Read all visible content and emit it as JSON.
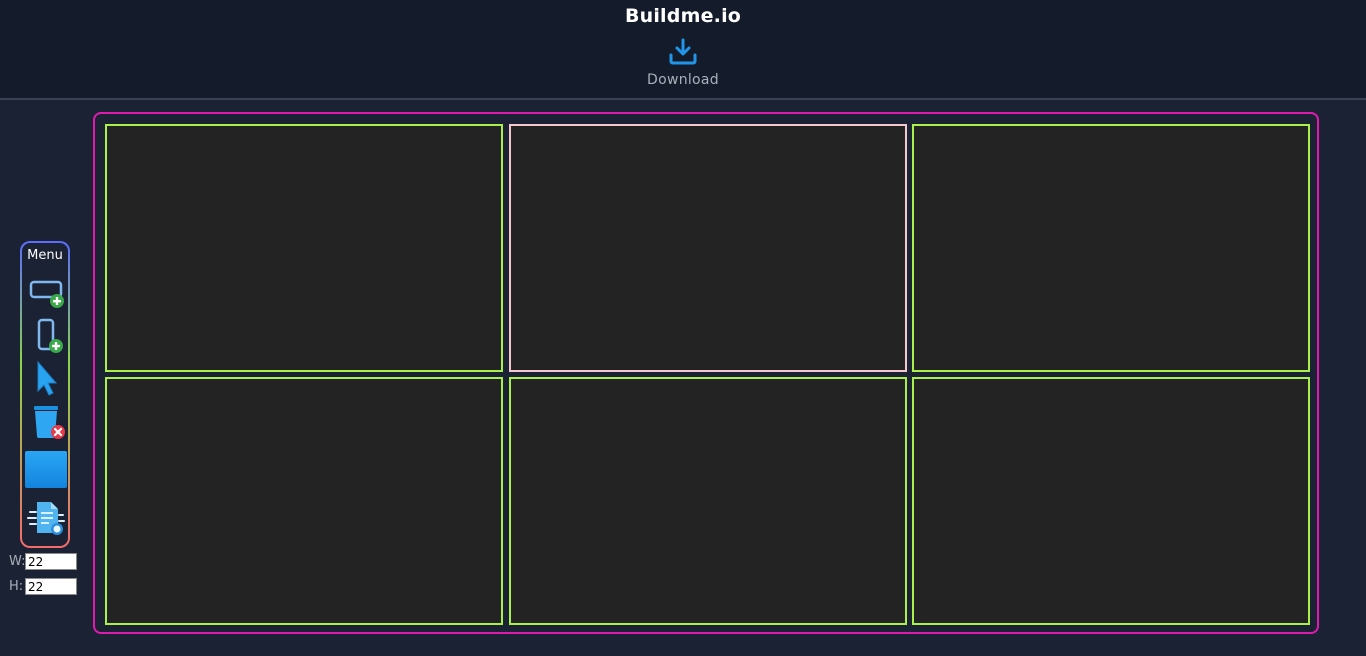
{
  "header": {
    "title": "Buildme.io",
    "download": {
      "label": "Download",
      "icon": "download-icon"
    }
  },
  "menu": {
    "title": "Menu",
    "tools": [
      {
        "name": "add-row-tool",
        "icon": "horizontal-rect-add-icon"
      },
      {
        "name": "add-column-tool",
        "icon": "vertical-rect-add-icon"
      },
      {
        "name": "select-tool",
        "icon": "cursor-arrow-icon"
      },
      {
        "name": "delete-tool",
        "icon": "trash-delete-icon"
      },
      {
        "name": "color-swatch",
        "icon": "blue-square-swatch"
      },
      {
        "name": "export-code-tool",
        "icon": "file-code-icon"
      }
    ]
  },
  "dimensions": {
    "width_label": "W:",
    "width_value": "22",
    "height_label": "H:",
    "height_value": "22"
  },
  "grid": {
    "rows": 2,
    "columns": 3,
    "selected_cell": [
      0,
      1
    ],
    "colors": {
      "canvas_border": "#e21bb0",
      "cell_border": "#a9f04a",
      "selected_border": "#f2c7cf",
      "cell_fill": "#232323"
    }
  },
  "colors": {
    "background": "#1a2233",
    "header_background": "#141c2c",
    "accent_blue": "#2196e8"
  }
}
